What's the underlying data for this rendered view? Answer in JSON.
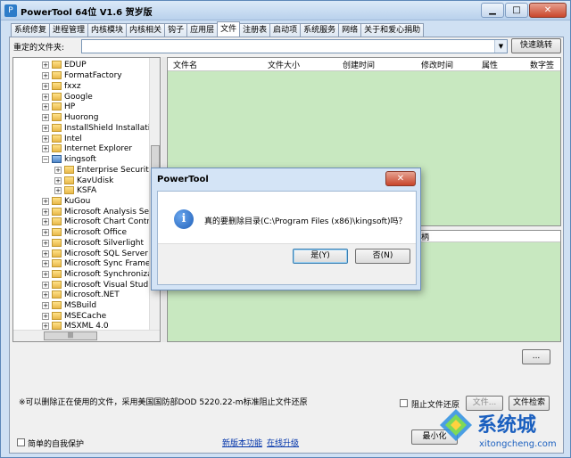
{
  "window": {
    "title": "PowerTool 64位 V1.6 贺岁版"
  },
  "tabs": [
    "系统修复",
    "进程管理",
    "内核模块",
    "内核相关",
    "钩子",
    "应用层",
    "文件",
    "注册表",
    "启动项",
    "系统服务",
    "网络",
    "关于和爱心捐助"
  ],
  "active_tab": "文件",
  "redirect": {
    "label": "重定的文件夹:",
    "value": "",
    "jump_button": "快速跳转"
  },
  "tree": {
    "items": [
      {
        "label": "EDUP"
      },
      {
        "label": "FormatFactory"
      },
      {
        "label": "fxxz"
      },
      {
        "label": "Google"
      },
      {
        "label": "HP"
      },
      {
        "label": "Huorong"
      },
      {
        "label": "InstallShield Installation"
      },
      {
        "label": "Intel"
      },
      {
        "label": "Internet Explorer"
      },
      {
        "label": "kingsoft"
      },
      {
        "label": "Enterprise Security"
      },
      {
        "label": "KavUdisk"
      },
      {
        "label": "KSFA"
      },
      {
        "label": "KuGou"
      },
      {
        "label": "Microsoft Analysis Servi"
      },
      {
        "label": "Microsoft Chart Control"
      },
      {
        "label": "Microsoft Office"
      },
      {
        "label": "Microsoft Silverlight"
      },
      {
        "label": "Microsoft SQL Server C"
      },
      {
        "label": "Microsoft Sync Framew"
      },
      {
        "label": "Microsoft Synchronizati"
      },
      {
        "label": "Microsoft Visual Studio"
      },
      {
        "label": "Microsoft.NET"
      },
      {
        "label": "MSBuild"
      },
      {
        "label": "MSECache"
      },
      {
        "label": "MSXML 4.0"
      }
    ]
  },
  "file_columns": [
    "文件名",
    "文件大小",
    "创建时间",
    "修改时间",
    "属性",
    "数字签"
  ],
  "lower_column": "柄",
  "more_button": "...",
  "warning": "※可以删除正在使用的文件，采用美国国防部DOD 5220.22-m标准阻止文件还原",
  "prevent_restore": "阻止文件还原",
  "file_btn": "文件...",
  "file_search": "文件检索",
  "simple_protect": "简单的自我保护",
  "new_feature": "新版本功能",
  "online_upgrade": "在线升级",
  "minimize_btn": "最小化",
  "dialog": {
    "title": "PowerTool",
    "message": "真的要删除目录(C:\\Program Files (x86)\\kingsoft)吗？",
    "yes": "是(Y)",
    "no": "否(N)"
  },
  "watermark": {
    "text": "系统城",
    "url": "xitongcheng.com"
  }
}
